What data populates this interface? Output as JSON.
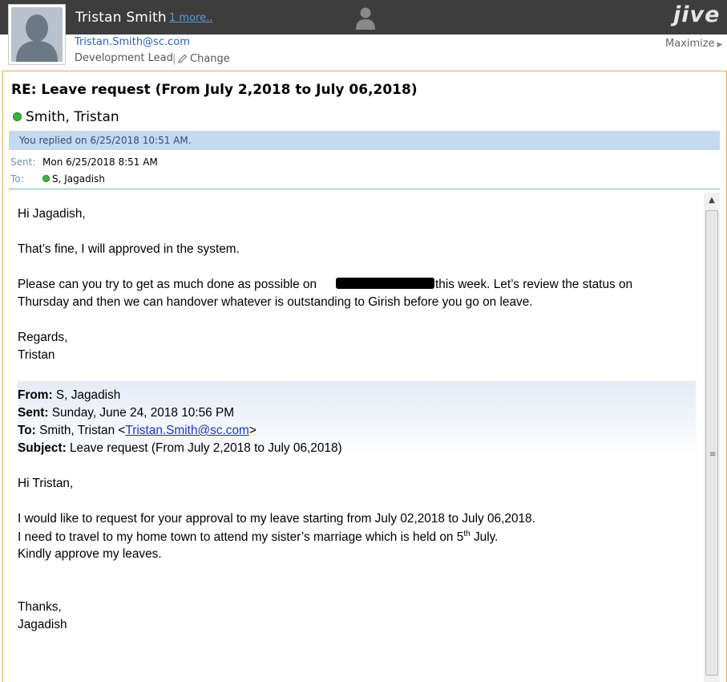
{
  "header": {
    "user_name": "Tristan Smith",
    "more_link": "1 more..",
    "email": "Tristan.Smith@sc.com",
    "role": "Development Lead",
    "separator": "|",
    "change_label": "Change",
    "brand": "jive",
    "maximize_label": "Maximize"
  },
  "message": {
    "subject": "RE: Leave request (From July 2,2018 to July 06,2018)",
    "sender": "Smith, Tristan",
    "replied_info": "You replied on 6/25/2018 10:51 AM.",
    "sent_label": "Sent:",
    "sent_value": "Mon 6/25/2018 8:51 AM",
    "to_label": "To:",
    "to_value": "S, Jagadish"
  },
  "body": {
    "greeting": "Hi Jagadish,",
    "line1": "That’s fine, I will approved in the system.",
    "line2a": "Please can you try to get as much done as possible on",
    "line2b": "this week. Let’s review the status on",
    "line3": "Thursday and then we can handover whatever is outstanding to Girish before you go on leave.",
    "regards": "Regards,",
    "signature": "Tristan"
  },
  "quoted": {
    "from_label": "From:",
    "from_value": "S, Jagadish",
    "sent_label": "Sent:",
    "sent_value": "Sunday, June 24, 2018 10:56 PM",
    "to_label": "To:",
    "to_name": "Smith, Tristan <",
    "to_email": "Tristan.Smith@sc.com",
    "to_close": ">",
    "subject_label": "Subject:",
    "subject_value": "Leave request (From July 2,2018 to July 06,2018)",
    "greeting": "Hi Tristan,",
    "line1": "I would like to request for your approval to my leave starting from July 02,2018 to July 06,2018.",
    "line2a": "I need to travel to my home town to attend  my sister’s marriage which is held on 5",
    "line2_sup": "th",
    "line2b": " July.",
    "line3": "Kindly approve my leaves.",
    "thanks": "Thanks,",
    "signature": "Jagadish"
  },
  "colors": {
    "topbar": "#3d3d3d",
    "pane_border": "#e7a94a",
    "replied_banner": "#c5d9ef",
    "presence_online": "#3cb23c",
    "link": "#1c33c7"
  },
  "icons": [
    "person-icon",
    "pencil-icon",
    "presence-online-icon",
    "scroll-up-icon",
    "scroll-grip-icon",
    "chevron-right-icon"
  ]
}
